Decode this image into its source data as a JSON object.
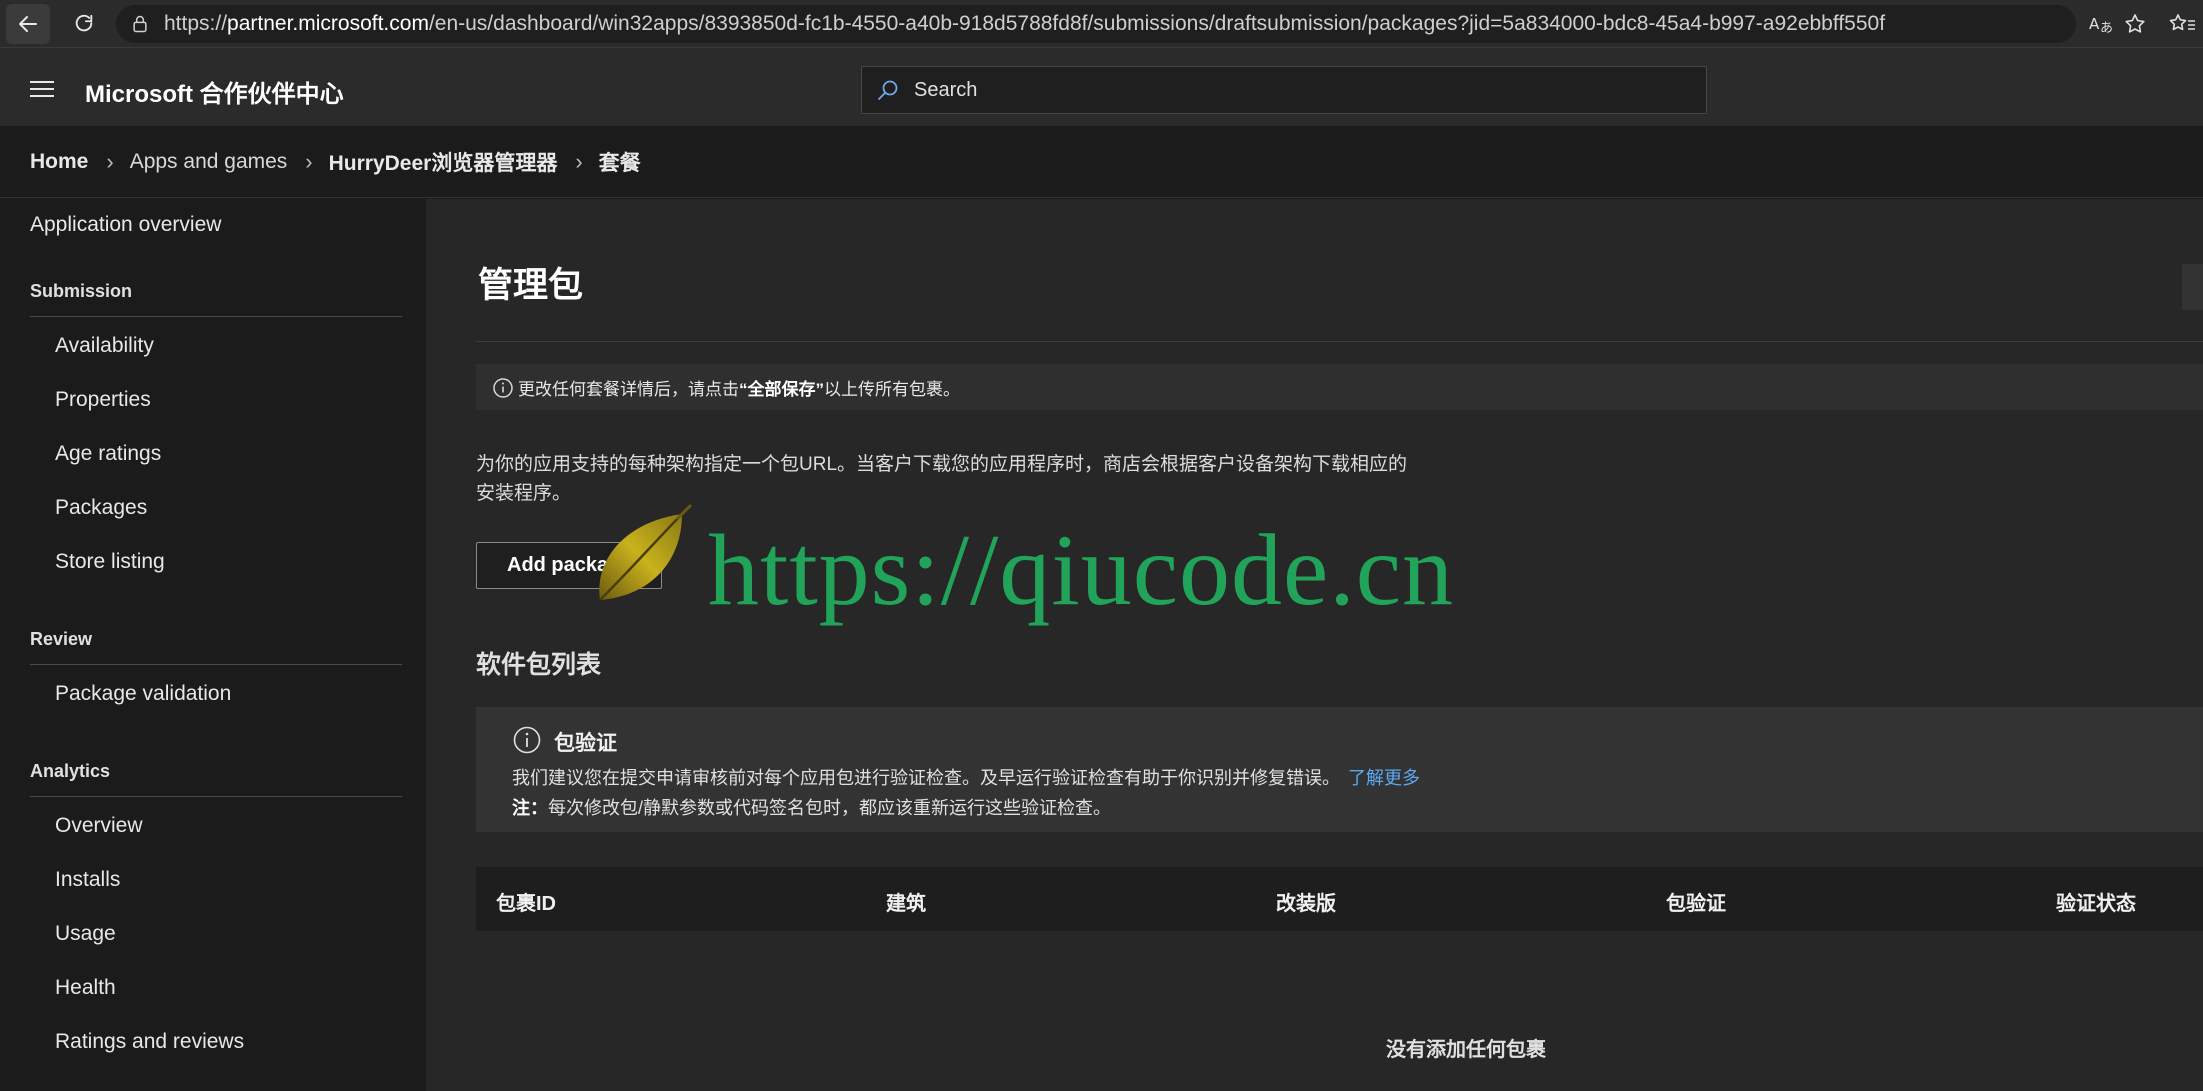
{
  "browser": {
    "url_prefix": "https://",
    "url_host": "partner.microsoft.com",
    "url_path": "/en-us/dashboard/win32apps/8393850d-fc1b-4550-a40b-918d5788fd8f/submissions/draftsubmission/packages?jid=5a834000-bdc8-45a4-b997-a92ebbff550f"
  },
  "header": {
    "brand": "Microsoft 合作伙伴中心",
    "search_placeholder": "Search"
  },
  "breadcrumb": {
    "items": [
      "Home",
      "Apps and games",
      "HurryDeer浏览器管理器",
      "套餐"
    ]
  },
  "sidebar": {
    "overview": "Application overview",
    "sections": [
      {
        "title": "Submission",
        "items": [
          "Availability",
          "Properties",
          "Age ratings",
          "Packages",
          "Store listing"
        ]
      },
      {
        "title": "Review",
        "items": [
          "Package validation"
        ]
      },
      {
        "title": "Analytics",
        "items": [
          "Overview",
          "Installs",
          "Usage",
          "Health",
          "Ratings and reviews"
        ]
      }
    ]
  },
  "main": {
    "title": "管理包",
    "banner": {
      "before": "更改任何套餐详情后，请点击",
      "bold": "“全部保存”",
      "after": "以上传所有包裹。"
    },
    "intro": "为你的应用支持的每种架构指定一个包URL。当客户下载您的应用程序时，商店会根据客户设备架构下载相应的安装程序。",
    "add_button": "Add package",
    "list_title": "软件包列表",
    "validation": {
      "heading": "包验证",
      "line1": "我们建议您在提交申请审核前对每个应用包进行验证检查。及早运行验证检查有助于你识别并修复错误。",
      "learn_more": "了解更多",
      "note_label": "注：",
      "note_text": "每次修改包/静默参数或代码签名包时，都应该重新运行这些验证检查。"
    },
    "table": {
      "columns": [
        "包裹ID",
        "建筑",
        "改装版",
        "包验证",
        "验证状态"
      ],
      "empty": "没有添加任何包裹"
    }
  },
  "watermark": {
    "text": "https://qiucode.cn"
  }
}
